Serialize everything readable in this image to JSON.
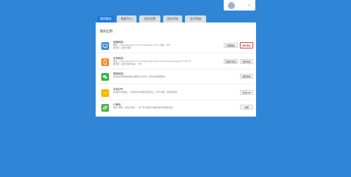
{
  "user": {
    "caret": "⌄"
  },
  "tabs": [
    {
      "label": "我的服务",
      "active": true
    },
    {
      "label": "数据中心",
      "active": false
    },
    {
      "label": "短信设置",
      "active": false
    },
    {
      "label": "我的资料",
      "active": false
    },
    {
      "label": "会员等级",
      "active": false
    }
  ],
  "panel": {
    "title": "我的应用"
  },
  "apps": [
    {
      "name": "电脑网站",
      "line1": "网址：anqiyuaiyingv1777.xiao.lbdyiyeeu.net.cn 备案：18%",
      "line2": "服务器：免费可使用",
      "buttons": [
        {
          "label": "管理网站",
          "outlined": false
        },
        {
          "label": "绑定域名",
          "outlined": true
        }
      ],
      "color": "#3a86d8",
      "icon": "monitor-icon"
    },
    {
      "name": "手机网站",
      "line1": "网址：anqiyuaiyingv1777.xiao.lbdyiyeeu.net.cn/wap.anqiyuaiyingv1777.html.fr",
      "line2": "服务器：免费可使用 备案：18%",
      "buttons": [
        {
          "label": "管理手机站",
          "outlined": false
        },
        {
          "label": "绑定域名",
          "outlined": true
        }
      ],
      "color": "#f08a24",
      "icon": "mobile-icon"
    },
    {
      "name": "微信网站",
      "line1": "将您的手机网站在微信中绑定公众号中，访问关注您的网站！",
      "line2": "",
      "buttons": [
        {
          "label": "绑定微信",
          "outlined": false
        }
      ],
      "color": "#36b34a",
      "icon": "wechat-icon"
    },
    {
      "name": "手机APP",
      "line1": "将您的手机网站，一键生成APP安装包到手机上（安卓/苹果，完整版可用）",
      "line2": "",
      "buttons": [
        {
          "label": "开启APP",
          "outlined": false
        }
      ],
      "color": "#f5b700",
      "icon": "app-icon"
    },
    {
      "name": "小程序",
      "line1": "微信小程序，操作小程序，一建一件不需要下载操作即可使用的应用！",
      "line2": "",
      "buttons": [
        {
          "label": "管理",
          "outlined": false
        }
      ],
      "color": "#4caf50",
      "icon": "link-icon"
    }
  ]
}
